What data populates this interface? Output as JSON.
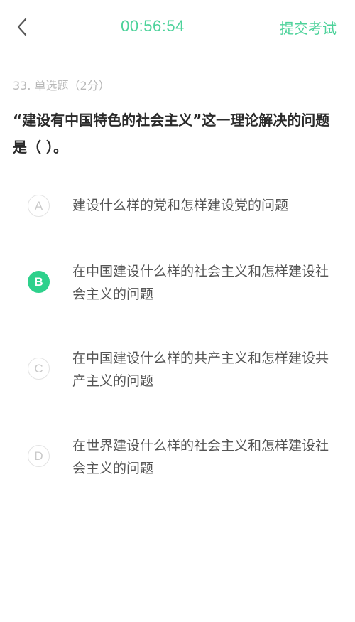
{
  "header": {
    "timer": "00:56:54",
    "submit_label": "提交考试"
  },
  "question": {
    "meta": "33. 单选题（2分）",
    "text": "“建设有中国特色的社会主义”这一理论解决的问题是（ ）。"
  },
  "options": [
    {
      "letter": "A",
      "text": "建设什么样的党和怎样建设党的问题",
      "selected": false
    },
    {
      "letter": "B",
      "text": "在中国建设什么样的社会主义和怎样建设社会主义的问题",
      "selected": true
    },
    {
      "letter": "C",
      "text": "在中国建设什么样的共产主义和怎样建设共产主义的问题",
      "selected": false
    },
    {
      "letter": "D",
      "text": "在世界建设什么样的社会主义和怎样建设社会主义的问题",
      "selected": false
    }
  ],
  "colors": {
    "accent": "#4cd29a",
    "selected": "#2ed18c"
  },
  "icons": {
    "back": "chevron-left-icon"
  }
}
